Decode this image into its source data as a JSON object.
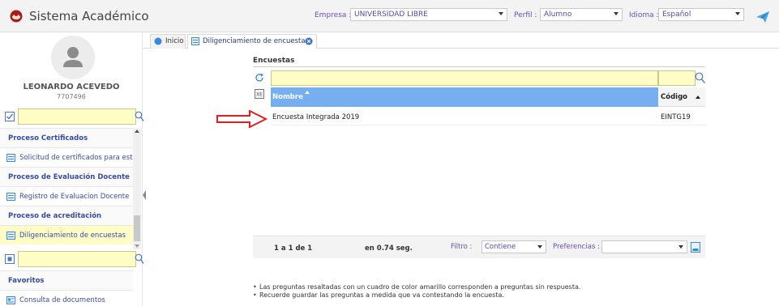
{
  "header": {
    "app_title": "Sistema Académico",
    "empresa_label": "Empresa :",
    "empresa_value": "UNIVERSIDAD LIBRE",
    "perfil_label": "Perfil :",
    "perfil_value": "Alumno",
    "idioma_label": "Idioma :",
    "idioma_value": "Español",
    "accent_color": "#6a4fb0"
  },
  "user": {
    "name": "LEONARDO ACEVEDO",
    "id": "7707496"
  },
  "sidebar": {
    "sections": [
      {
        "category": "Proceso Certificados",
        "items": [
          "Solicitud de certificados para estu"
        ]
      },
      {
        "category": "Proceso de Evaluación Docente",
        "items": [
          "Registro de Evaluacion Docente"
        ]
      },
      {
        "category": "Proceso de acreditación",
        "items": [
          "Diligenciamiento de encuestas"
        ]
      }
    ],
    "favorites_label": "Favoritos",
    "favorites_items": [
      "Consulta de documentos"
    ]
  },
  "tabs": [
    {
      "label": "Inicio"
    },
    {
      "label": "Diligenciamiento de encuestas"
    }
  ],
  "panel": {
    "title": "Encuestas",
    "columns": [
      "Nombre",
      "Código"
    ],
    "rows": [
      {
        "name": "Encuesta Integrada 2019",
        "code": "EINTG19"
      }
    ]
  },
  "footer": {
    "pager": "1 a 1 de 1",
    "timing": "en 0.74 seg.",
    "filtro_label": "Filtro :",
    "filtro_value": "Contiene",
    "preferencias_label": "Preferencias :",
    "preferencias_value": ""
  },
  "notes": [
    "Las preguntas resaltadas con un cuadro de color amarillo corresponden a preguntas sin respuesta.",
    "Recuerde guardar las preguntas a medida que va contestando la encuesta."
  ],
  "colors": {
    "header_bg": "#f3f3f3",
    "table_header": "#77aef0",
    "filter_yellow": "#fffdc6",
    "menu_text": "#3a4aa0",
    "arrow_red": "#e02020"
  }
}
